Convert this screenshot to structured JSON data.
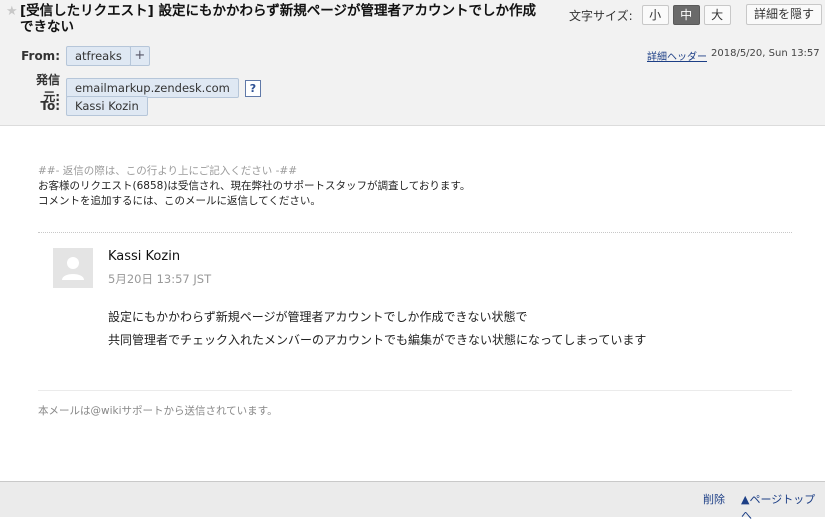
{
  "header": {
    "star": "★",
    "subject": "[受信したリクエスト] 設定にもかかわらず新規ページが管理者アカウントでしか作成できない",
    "font_size": {
      "label": "文字サイズ:",
      "small": "小",
      "medium": "中",
      "large": "大",
      "selected": "中"
    },
    "hide_details": "詳細を隠す",
    "from": {
      "label": "From:",
      "value": "atfreaks",
      "add": "+"
    },
    "sender": {
      "label": "発信元:",
      "value": "emailmarkup.zendesk.com",
      "help": "?"
    },
    "to": {
      "label": "To:",
      "value": "Kassi Kozin"
    },
    "detail_header_link": "詳細ヘッダー",
    "date": "2018/5/20, Sun 13:57"
  },
  "message": {
    "reply_note": "##- 返信の際は、この行より上にご記入ください -##",
    "intro_line1": "お客様のリクエスト(6858)は受信され、現在弊社のサポートスタッフが調査しております。",
    "intro_line2": "コメントを追加するには、このメールに返信してください。",
    "comment": {
      "author": "Kassi Kozin",
      "time": "5月20日 13:57 JST",
      "body_line1": "設定にもかかわらず新規ページが管理者アカウントでしか作成できない状態で",
      "body_line2": "共同管理者でチェック入れたメンバーのアカウントでも編集ができない状態になってしまっています"
    },
    "footer_note": "本メールは@wikiサポートから送信されています。"
  },
  "footer": {
    "delete": "削除",
    "page_top": "▲ページトップへ"
  }
}
